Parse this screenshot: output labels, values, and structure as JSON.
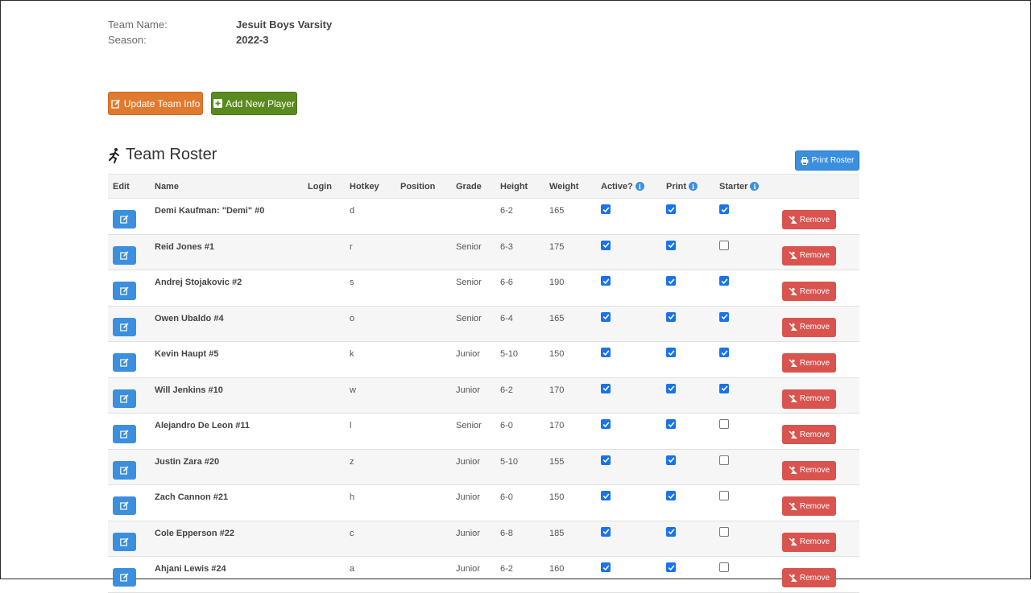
{
  "team": {
    "name_label": "Team Name:",
    "name_value": "Jesuit Boys Varsity",
    "season_label": "Season:",
    "season_value": "2022-3"
  },
  "buttons": {
    "update_team": "Update Team Info",
    "add_player": "Add New Player",
    "print_roster": "Print Roster",
    "remove": "Remove"
  },
  "roster": {
    "title": "Team Roster",
    "icon": "running-person-icon",
    "columns": [
      "Edit",
      "Name",
      "Login",
      "Hotkey",
      "Position",
      "Grade",
      "Height",
      "Weight",
      "Active?",
      "Print",
      "Starter"
    ],
    "rows": [
      {
        "name": "Demi Kaufman: \"Demi\" #0",
        "login": "",
        "hotkey": "d",
        "position": "",
        "grade": "",
        "height": "6-2",
        "weight": "165",
        "active": true,
        "print": true,
        "starter": true
      },
      {
        "name": "Reid Jones #1",
        "login": "",
        "hotkey": "r",
        "position": "",
        "grade": "Senior",
        "height": "6-3",
        "weight": "175",
        "active": true,
        "print": true,
        "starter": false
      },
      {
        "name": "Andrej Stojakovic #2",
        "login": "",
        "hotkey": "s",
        "position": "",
        "grade": "Senior",
        "height": "6-6",
        "weight": "190",
        "active": true,
        "print": true,
        "starter": true
      },
      {
        "name": "Owen Ubaldo #4",
        "login": "",
        "hotkey": "o",
        "position": "",
        "grade": "Senior",
        "height": "6-4",
        "weight": "165",
        "active": true,
        "print": true,
        "starter": true
      },
      {
        "name": "Kevin Haupt #5",
        "login": "",
        "hotkey": "k",
        "position": "",
        "grade": "Junior",
        "height": "5-10",
        "weight": "150",
        "active": true,
        "print": true,
        "starter": true
      },
      {
        "name": "Will Jenkins #10",
        "login": "",
        "hotkey": "w",
        "position": "",
        "grade": "Junior",
        "height": "6-2",
        "weight": "170",
        "active": true,
        "print": true,
        "starter": true
      },
      {
        "name": "Alejandro De Leon #11",
        "login": "",
        "hotkey": "l",
        "position": "",
        "grade": "Senior",
        "height": "6-0",
        "weight": "170",
        "active": true,
        "print": true,
        "starter": false
      },
      {
        "name": "Justin Zara #20",
        "login": "",
        "hotkey": "z",
        "position": "",
        "grade": "Junior",
        "height": "5-10",
        "weight": "155",
        "active": true,
        "print": true,
        "starter": false
      },
      {
        "name": "Zach Cannon #21",
        "login": "",
        "hotkey": "h",
        "position": "",
        "grade": "Junior",
        "height": "6-0",
        "weight": "150",
        "active": true,
        "print": true,
        "starter": false
      },
      {
        "name": "Cole Epperson #22",
        "login": "",
        "hotkey": "c",
        "position": "",
        "grade": "Junior",
        "height": "6-8",
        "weight": "185",
        "active": true,
        "print": true,
        "starter": false
      },
      {
        "name": "Ahjani Lewis #24",
        "login": "",
        "hotkey": "a",
        "position": "",
        "grade": "Junior",
        "height": "6-2",
        "weight": "160",
        "active": true,
        "print": true,
        "starter": false
      }
    ]
  },
  "colors": {
    "update_button": "#e07a2e",
    "add_button": "#5a8a1e",
    "primary_blue": "#3b8fde",
    "remove_red": "#d9534f"
  }
}
